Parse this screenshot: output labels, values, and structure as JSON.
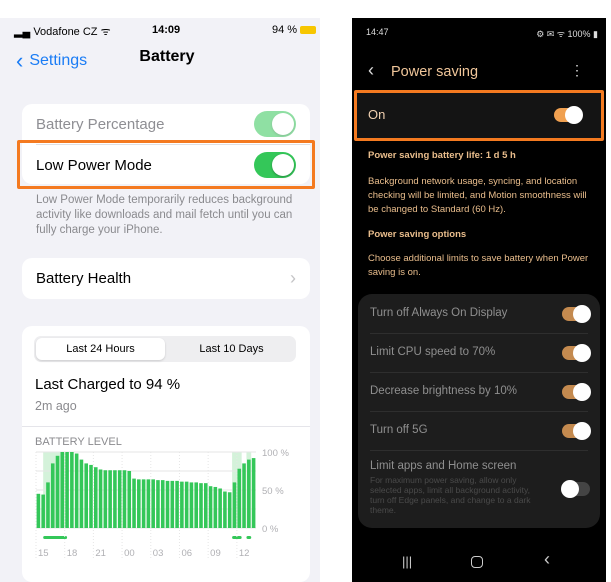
{
  "ios": {
    "status": {
      "carrier": "Vodafone CZ",
      "time": "14:09",
      "battery": "94 %"
    },
    "nav": {
      "back": "Settings",
      "title": "Battery"
    },
    "battery_percentage": {
      "label": "Battery Percentage",
      "on": true
    },
    "low_power_mode": {
      "label": "Low Power Mode",
      "on": true,
      "description": "Low Power Mode temporarily reduces background activity like downloads and mail fetch until you can fully charge your iPhone."
    },
    "battery_health": {
      "label": "Battery Health"
    },
    "tabs": [
      "Last 24 Hours",
      "Last 10 Days"
    ],
    "last_charged": "Last Charged to 94 %",
    "last_charged_ago": "2m ago",
    "chart_title": "BATTERY LEVEL",
    "highlight_color": "#f47a20"
  },
  "chart_data": {
    "type": "bar",
    "title": "BATTERY LEVEL",
    "x_tick_labels": [
      "15",
      "18",
      "21",
      "00",
      "03",
      "06",
      "09",
      "12"
    ],
    "y_tick_labels": [
      "100 %",
      "50 %",
      "0 %"
    ],
    "ylim": [
      0,
      100
    ],
    "interval": "30 min",
    "start": "15:00",
    "values": [
      45,
      44,
      60,
      85,
      95,
      100,
      100,
      100,
      98,
      90,
      85,
      83,
      80,
      77,
      76,
      76,
      76,
      76,
      76,
      75,
      65,
      64,
      64,
      64,
      64,
      63,
      63,
      62,
      62,
      62,
      61,
      61,
      60,
      60,
      59,
      59,
      55,
      54,
      52,
      48,
      47,
      60,
      78,
      85,
      90,
      92
    ],
    "charging_periods": [
      [
        "15:45",
        "18:15"
      ],
      [
        "11:30",
        "12:30"
      ],
      [
        "13:00",
        "13:30"
      ]
    ],
    "color": "#34c759",
    "grid": true
  },
  "android": {
    "status": {
      "time": "14:47",
      "battery": "100%"
    },
    "title": "Power saving",
    "master": {
      "label": "On",
      "on": true
    },
    "battery_life": "Power saving battery life: 1 d 5 h",
    "description": "Background network usage, syncing, and location checking will be limited, and Motion smoothness will be changed to Standard (60 Hz).",
    "options_header": "Power saving options",
    "options_description": "Choose additional limits to save battery when Power saving is on.",
    "options": [
      {
        "label": "Turn off Always On Display",
        "on": true
      },
      {
        "label": "Limit CPU speed to 70%",
        "on": true
      },
      {
        "label": "Decrease brightness by 10%",
        "on": true
      },
      {
        "label": "Turn off 5G",
        "on": true
      }
    ],
    "limit_apps": {
      "label": "Limit apps and Home screen",
      "description": "For maximum power saving, allow only selected apps, limit all background activity, turn off Edge panels, and change to a dark theme.",
      "on": false
    },
    "accent": "#f0a050"
  }
}
